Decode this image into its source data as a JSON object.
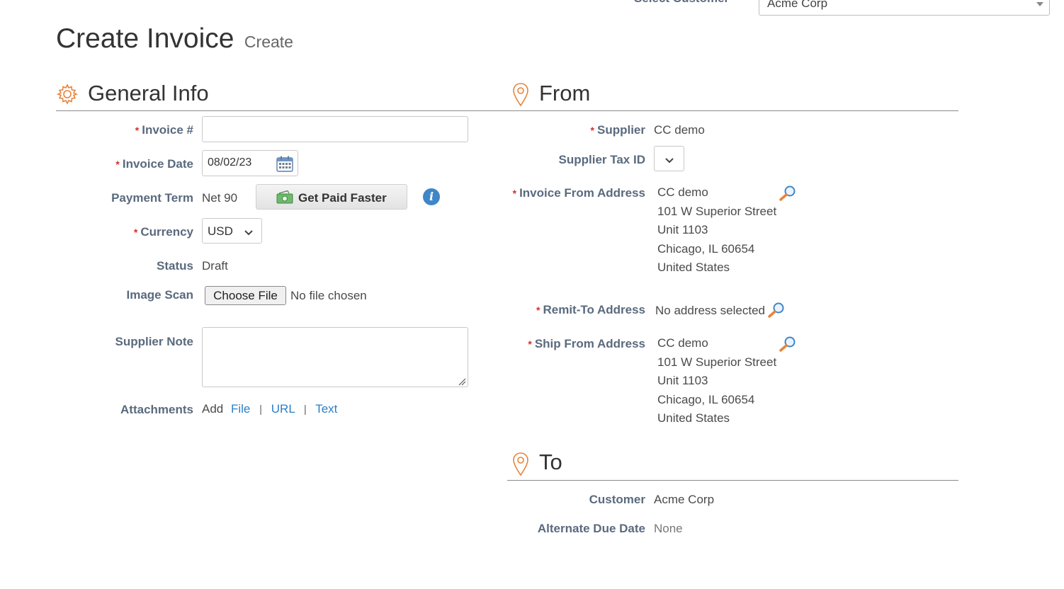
{
  "top": {
    "select_customer_label": "Select Customer",
    "customer_value": "Acme Corp"
  },
  "header": {
    "title": "Create Invoice",
    "subtitle": "Create"
  },
  "general": {
    "title": "General Info",
    "invoice_no_label": "Invoice #",
    "invoice_no_value": "",
    "invoice_date_label": "Invoice Date",
    "invoice_date_value": "08/02/23",
    "payment_term_label": "Payment Term",
    "payment_term_value": "Net 90",
    "get_paid_label": "Get Paid Faster",
    "currency_label": "Currency",
    "currency_value": "USD",
    "status_label": "Status",
    "status_value": "Draft",
    "image_scan_label": "Image Scan",
    "choose_file_label": "Choose File",
    "no_file_text": "No file chosen",
    "supplier_note_label": "Supplier Note",
    "attachments_label": "Attachments",
    "add_text": "Add",
    "file_link": "File",
    "url_link": "URL",
    "text_link": "Text"
  },
  "from": {
    "title": "From",
    "supplier_label": "Supplier",
    "supplier_value": "CC demo",
    "tax_id_label": "Supplier Tax ID",
    "invoice_from_label": "Invoice From Address",
    "invoice_from_lines": [
      "CC demo",
      "101 W Superior Street",
      "Unit 1103",
      "Chicago, IL 60654",
      "United States"
    ],
    "remit_to_label": "Remit-To Address",
    "remit_to_value": "No address selected",
    "ship_from_label": "Ship From Address",
    "ship_from_lines": [
      "CC demo",
      "101 W Superior Street",
      "Unit 1103",
      "Chicago, IL 60654",
      "United States"
    ]
  },
  "to": {
    "title": "To",
    "customer_label": "Customer",
    "customer_value": "Acme Corp",
    "alt_due_label": "Alternate Due Date",
    "alt_due_value": "None"
  },
  "colors": {
    "accent_orange": "#e8833a",
    "link_blue": "#2b7fc6",
    "required_red": "#d0312d",
    "label_gray": "#5a6a7e"
  }
}
